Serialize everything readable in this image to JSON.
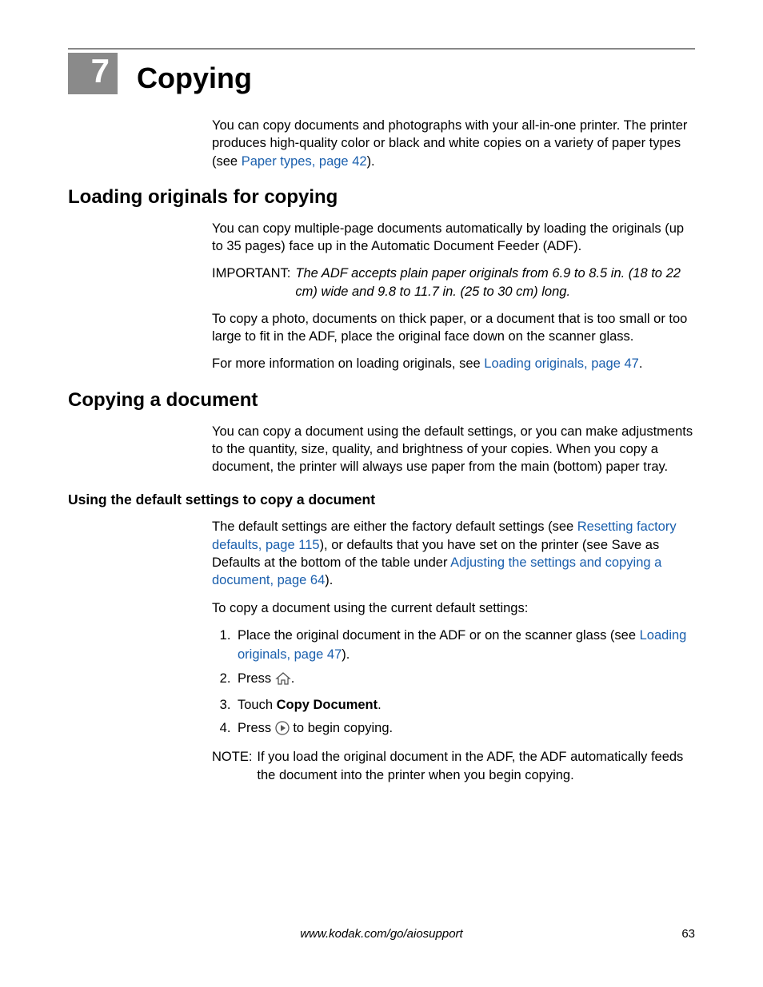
{
  "chapter": {
    "number": "7",
    "title": "Copying"
  },
  "intro": {
    "p1a": "You can copy documents and photographs with your all-in-one printer. The printer produces high-quality color or black and white copies on a variety of paper types (see ",
    "link1": "Paper types, page 42",
    "p1b": ")."
  },
  "sec1": {
    "heading": "Loading originals for copying",
    "p1": "You can copy multiple-page documents automatically by loading the originals (up to 35 pages) face up in the Automatic Document Feeder (ADF).",
    "importantLabel": "IMPORTANT:",
    "importantText": "The ADF accepts plain paper originals from 6.9 to 8.5 in. (18 to 22 cm) wide and 9.8 to 11.7 in. (25 to 30 cm) long.",
    "p2": "To copy a photo, documents on thick paper, or a document that is too small or too large to fit in the ADF, place the original face down on the scanner glass.",
    "p3a": "For more information on loading originals, see ",
    "link1": "Loading originals, page 47",
    "p3b": "."
  },
  "sec2": {
    "heading": "Copying a document",
    "p1": "You can copy a document using the default settings, or you can make adjustments to the quantity, size, quality, and brightness of your copies. When you copy a document, the printer will always use paper from the main (bottom) paper tray.",
    "sub1": {
      "heading": "Using the default settings to copy a document",
      "p1a": "The default settings are either the factory default settings (see ",
      "link1": "Resetting factory defaults, page 115",
      "p1b": "), or defaults that you have set on the printer (see Save as Defaults at the bottom of the table under ",
      "link2": "Adjusting the settings and copying a document, page 64",
      "p1c": ").",
      "p2": "To copy a document using the current default settings:",
      "step1a": "Place the original document in the ADF or on the scanner glass (see ",
      "step1link": "Loading originals, page 47",
      "step1b": ").",
      "step2a": "Press ",
      "step2b": ".",
      "step3a": "Touch ",
      "step3bold": "Copy Document",
      "step3b": ".",
      "step4a": "Press ",
      "step4b": " to begin copying.",
      "noteLabel": "NOTE:",
      "noteText": "If you load the original document in the ADF, the ADF automatically feeds the document into the printer when you begin copying."
    }
  },
  "footer": {
    "url": "www.kodak.com/go/aiosupport",
    "page": "63"
  }
}
